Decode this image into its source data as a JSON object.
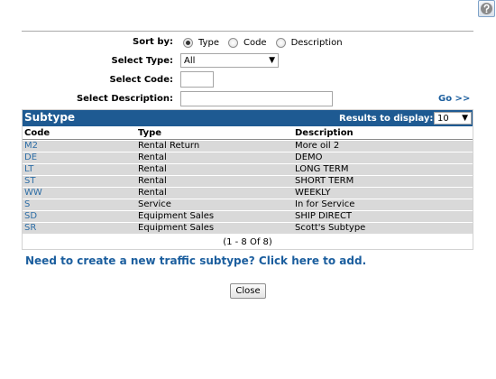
{
  "help_icon": "question-circle-icon",
  "form": {
    "sort_by_label": "Sort by:",
    "sort_options": [
      "Type",
      "Code",
      "Description"
    ],
    "sort_selected": "Type",
    "type_label": "Select Type:",
    "type_value": "All",
    "code_label": "Select Code:",
    "code_value": "",
    "desc_label": "Select Description:",
    "desc_value": "",
    "go_label": "Go >>"
  },
  "grid": {
    "title": "Subtype",
    "results_label": "Results to display:",
    "results_value": "10",
    "columns": [
      "Code",
      "Type",
      "Description"
    ],
    "rows": [
      {
        "code": "M2",
        "type": "Rental Return",
        "description": "More oil 2"
      },
      {
        "code": "DE",
        "type": "Rental",
        "description": "DEMO"
      },
      {
        "code": "LT",
        "type": "Rental",
        "description": "LONG TERM"
      },
      {
        "code": "ST",
        "type": "Rental",
        "description": "SHORT TERM"
      },
      {
        "code": "WW",
        "type": "Rental",
        "description": "WEEKLY"
      },
      {
        "code": "S",
        "type": "Service",
        "description": "In for Service"
      },
      {
        "code": "SD",
        "type": "Equipment Sales",
        "description": "SHIP DIRECT"
      },
      {
        "code": "SR",
        "type": "Equipment Sales",
        "description": "Scott's Subtype"
      }
    ],
    "pager": "(1  - 8  Of 8)"
  },
  "add_link": "Need to create a new traffic subtype? Click here to add.",
  "close_label": "Close",
  "colors": {
    "header_bg": "#1e5a92",
    "link": "#1b5e9e",
    "row_bg": "#d9d9d9",
    "code_link": "#2e6ea6"
  }
}
